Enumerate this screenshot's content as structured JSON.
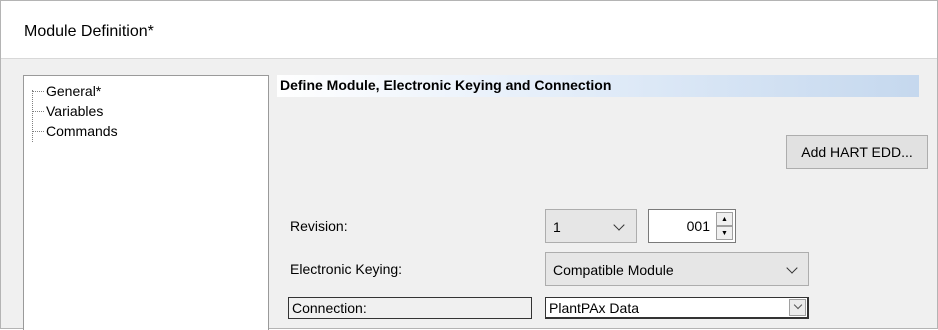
{
  "window": {
    "title": "Module Definition*"
  },
  "tree": {
    "items": [
      {
        "label": "General*"
      },
      {
        "label": "Variables"
      },
      {
        "label": "Commands"
      }
    ]
  },
  "section": {
    "title": "Define Module, Electronic Keying and Connection"
  },
  "buttons": {
    "add_hart_edd": "Add HART EDD..."
  },
  "form": {
    "revision": {
      "label": "Revision:",
      "major": "1",
      "minor": "001"
    },
    "electronic_keying": {
      "label": "Electronic Keying:",
      "value": "Compatible Module"
    },
    "connection": {
      "label": "Connection:",
      "value": "PlantPAx Data"
    }
  }
}
